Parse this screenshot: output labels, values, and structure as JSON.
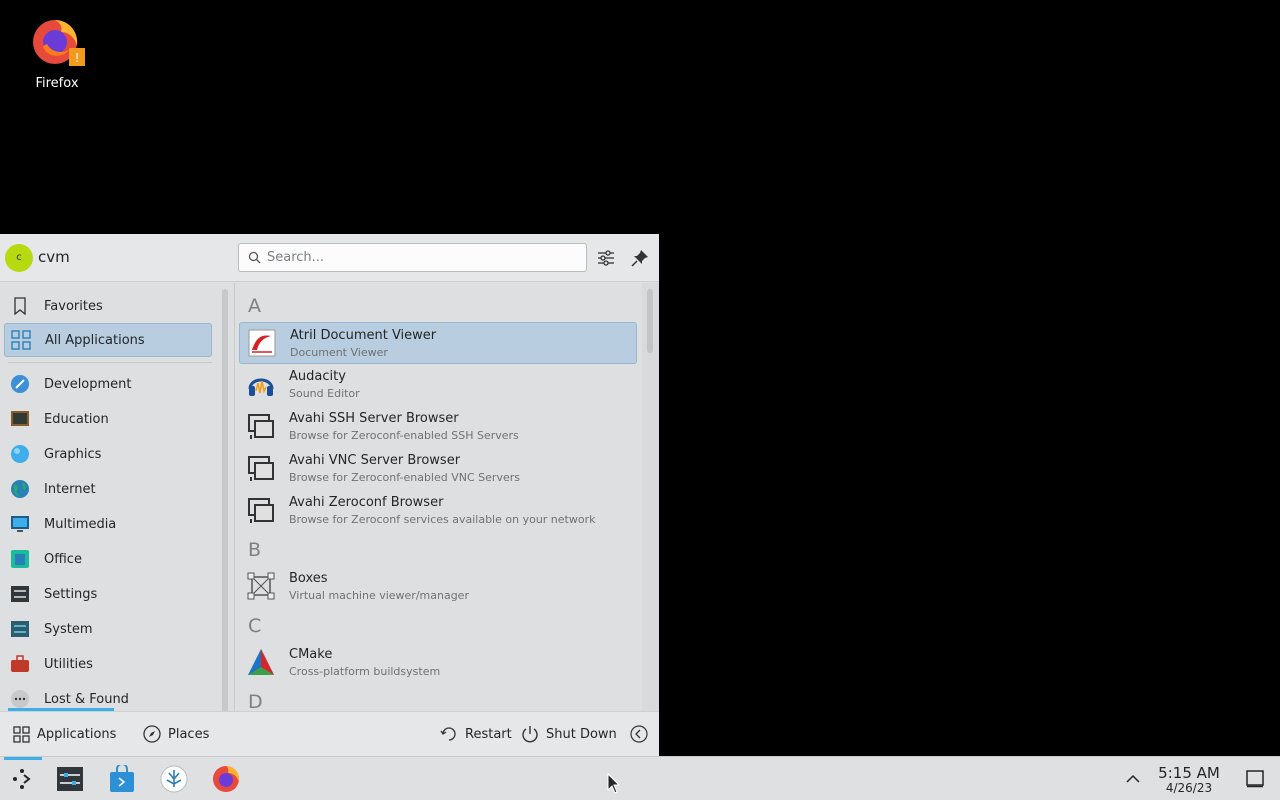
{
  "desktop": {
    "icons": [
      {
        "label": "Firefox",
        "icon": "firefox-icon"
      }
    ]
  },
  "launcher": {
    "user": {
      "initial": "c",
      "name": "cvm"
    },
    "search": {
      "placeholder": "Search..."
    },
    "header_buttons": [
      {
        "icon": "configure-icon"
      },
      {
        "icon": "pin-icon"
      }
    ],
    "sidebar": {
      "items": [
        {
          "label": "Favorites",
          "icon": "bookmark-icon"
        },
        {
          "label": "All Applications",
          "icon": "grid-icon",
          "active": true
        },
        {
          "label": "Development",
          "icon": "development-icon"
        },
        {
          "label": "Education",
          "icon": "education-icon"
        },
        {
          "label": "Graphics",
          "icon": "graphics-icon"
        },
        {
          "label": "Internet",
          "icon": "internet-icon"
        },
        {
          "label": "Multimedia",
          "icon": "multimedia-icon"
        },
        {
          "label": "Office",
          "icon": "office-icon"
        },
        {
          "label": "Settings",
          "icon": "settings-icon"
        },
        {
          "label": "System",
          "icon": "system-icon"
        },
        {
          "label": "Utilities",
          "icon": "utilities-icon"
        },
        {
          "label": "Lost & Found",
          "icon": "more-icon"
        }
      ]
    },
    "apps": {
      "letters": [
        "A",
        "B",
        "C",
        "D"
      ],
      "items": [
        {
          "name": "Atril Document Viewer",
          "desc": "Document Viewer",
          "icon": "atril-icon",
          "active": true
        },
        {
          "name": "Audacity",
          "desc": "Sound Editor",
          "icon": "audacity-icon"
        },
        {
          "name": "Avahi SSH Server Browser",
          "desc": "Browse for Zeroconf-enabled SSH Servers",
          "icon": "network-computer-icon"
        },
        {
          "name": "Avahi VNC Server Browser",
          "desc": "Browse for Zeroconf-enabled VNC Servers",
          "icon": "network-computer-icon"
        },
        {
          "name": "Avahi Zeroconf Browser",
          "desc": "Browse for Zeroconf services available on your network",
          "icon": "network-computer-icon"
        },
        {
          "name": "Boxes",
          "desc": "Virtual machine viewer/manager",
          "icon": "boxes-icon"
        },
        {
          "name": "CMake",
          "desc": "Cross-platform buildsystem",
          "icon": "cmake-icon"
        }
      ]
    },
    "footer": {
      "applications": "Applications",
      "places": "Places",
      "restart": "Restart",
      "shutdown": "Shut Down"
    }
  },
  "taskbar": {
    "items": [
      "app-launcher-icon",
      "system-settings-icon",
      "discover-icon",
      "plasma-icon",
      "firefox-icon"
    ],
    "clock": {
      "time": "5:15 AM",
      "date": "4/26/23"
    },
    "tray": [
      "tray-expand-icon",
      "show-desktop-icon"
    ]
  },
  "colors": {
    "accent": "#3daee9",
    "highlight": "#b8cde0",
    "panel": "#dfe0e2"
  }
}
